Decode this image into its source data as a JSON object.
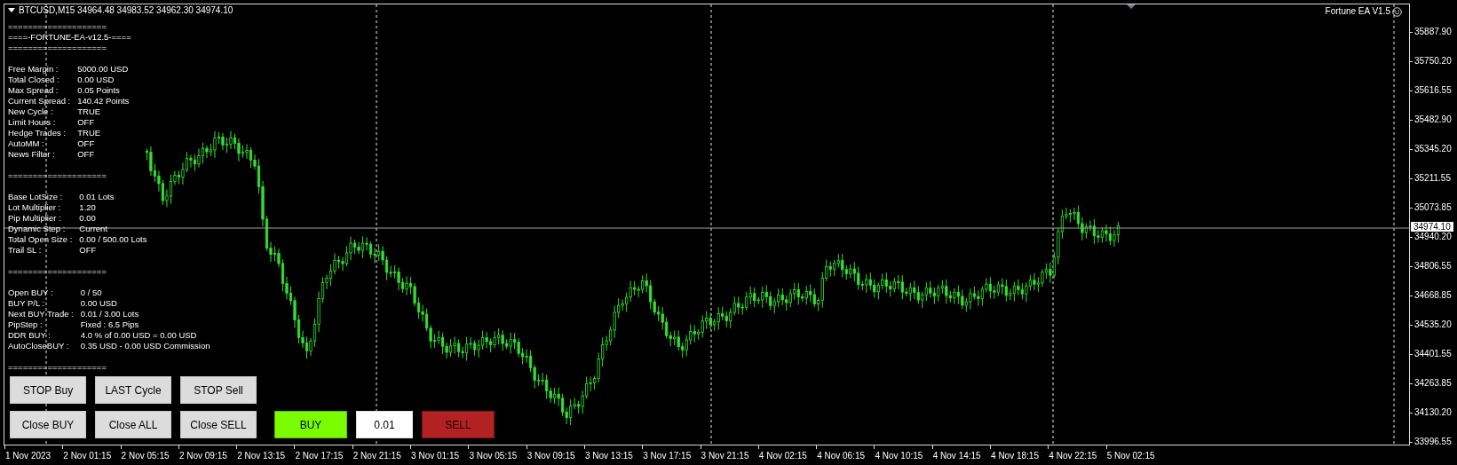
{
  "chart": {
    "title": "BTCUSD,M15 34964.48 34983.52 34962.30 34974.10",
    "ea_label": "Fortune EA V1.5",
    "info_panel": [
      {
        "lines": [
          {
            "kind": "rule",
            "text": "===================="
          },
          {
            "kind": "title",
            "text": "====-FORTUNE-EA-v12.5-===="
          },
          {
            "kind": "rule",
            "text": "===================="
          }
        ]
      },
      {
        "lines": [
          {
            "kind": "row",
            "label": "Free Margin :",
            "value": "5000.00 USD"
          },
          {
            "kind": "row",
            "label": "Total Closed :",
            "value": "0.00 USD"
          },
          {
            "kind": "row",
            "label": "Max Spread :",
            "value": "0.05 Points"
          },
          {
            "kind": "row",
            "label": "Current Spread :",
            "value": "140.42 Points"
          },
          {
            "kind": "row",
            "label": "New Cycle :",
            "value": "TRUE"
          },
          {
            "kind": "row",
            "label": "Limit Hours :",
            "value": "OFF"
          },
          {
            "kind": "row",
            "label": "Hedge Trades :",
            "value": "TRUE"
          },
          {
            "kind": "row",
            "label": "AutoMM :",
            "value": "OFF"
          },
          {
            "kind": "row",
            "label": "News Filter :",
            "value": "OFF"
          }
        ]
      },
      {
        "lines": [
          {
            "kind": "rule",
            "text": "===================="
          }
        ]
      },
      {
        "lines": [
          {
            "kind": "row",
            "label": "Base LotSize :",
            "value": "0.01 Lots"
          },
          {
            "kind": "row",
            "label": "Lot Multiplier :",
            "value": "1.20"
          },
          {
            "kind": "row",
            "label": "Pip Multiplier :",
            "value": "0.00"
          },
          {
            "kind": "row",
            "label": "Dynamic Step :",
            "value": "Current"
          },
          {
            "kind": "row",
            "label": "Total Open Size :",
            "value": "0.00 / 500.00 Lots"
          },
          {
            "kind": "row",
            "label": "Trail SL :",
            "value": "OFF"
          }
        ]
      },
      {
        "lines": [
          {
            "kind": "rule",
            "text": "===================="
          }
        ]
      },
      {
        "lines": [
          {
            "kind": "row",
            "label": "Open BUY :",
            "value": "0 / 50"
          },
          {
            "kind": "row",
            "label": "BUY P/L :",
            "value": "0.00 USD"
          },
          {
            "kind": "row",
            "label": "Next BUY Trade :",
            "value": "0.01 / 3.00 Lots"
          },
          {
            "kind": "row",
            "label": "PipStep :",
            "value": "Fixed : 6.5 Pips"
          },
          {
            "kind": "row",
            "label": "DDR BUY :",
            "value": "4.0 % of 0.00 USD = 0.00 USD"
          },
          {
            "kind": "row",
            "label": "AutoCloseBUY :",
            "value": "0.35 USD - 0.00 USD Commission"
          }
        ]
      },
      {
        "lines": [
          {
            "kind": "rule",
            "text": "===================="
          }
        ]
      }
    ],
    "button_rows": [
      {
        "buttons": [
          {
            "kind": "gray",
            "label": "STOP Buy"
          },
          {
            "kind": "gray",
            "label": "LAST Cycle"
          },
          {
            "kind": "gray",
            "label": "STOP Sell"
          }
        ]
      },
      {
        "buttons": [
          {
            "kind": "gray",
            "label": "Close BUY"
          },
          {
            "kind": "gray",
            "label": "Close ALL"
          },
          {
            "kind": "gray",
            "label": "Close SELL"
          },
          {
            "kind": "buy",
            "label": "BUY"
          },
          {
            "kind": "field",
            "label": "0.01"
          },
          {
            "kind": "sell",
            "label": "SELL"
          }
        ]
      }
    ]
  },
  "price_axis": {
    "labels": [
      "35887.90",
      "35750.20",
      "35616.55",
      "35482.90",
      "35345.20",
      "35211.55",
      "35073.85",
      "34940.20",
      "34806.55",
      "34668.85",
      "34535.20",
      "34401.55",
      "34263.85",
      "34130.20",
      "33996.55"
    ],
    "current_price": "34974.10"
  },
  "time_axis": {
    "labels": [
      "1 Nov 2023",
      "2 Nov 01:15",
      "2 Nov 05:15",
      "2 Nov 09:15",
      "2 Nov 13:15",
      "2 Nov 17:15",
      "2 Nov 21:15",
      "3 Nov 01:15",
      "3 Nov 05:15",
      "3 Nov 09:15",
      "3 Nov 13:15",
      "3 Nov 17:15",
      "3 Nov 21:15",
      "4 Nov 02:15",
      "4 Nov 06:15",
      "4 Nov 10:15",
      "4 Nov 14:15",
      "4 Nov 18:15",
      "4 Nov 22:15",
      "5 Nov 02:15"
    ]
  }
}
